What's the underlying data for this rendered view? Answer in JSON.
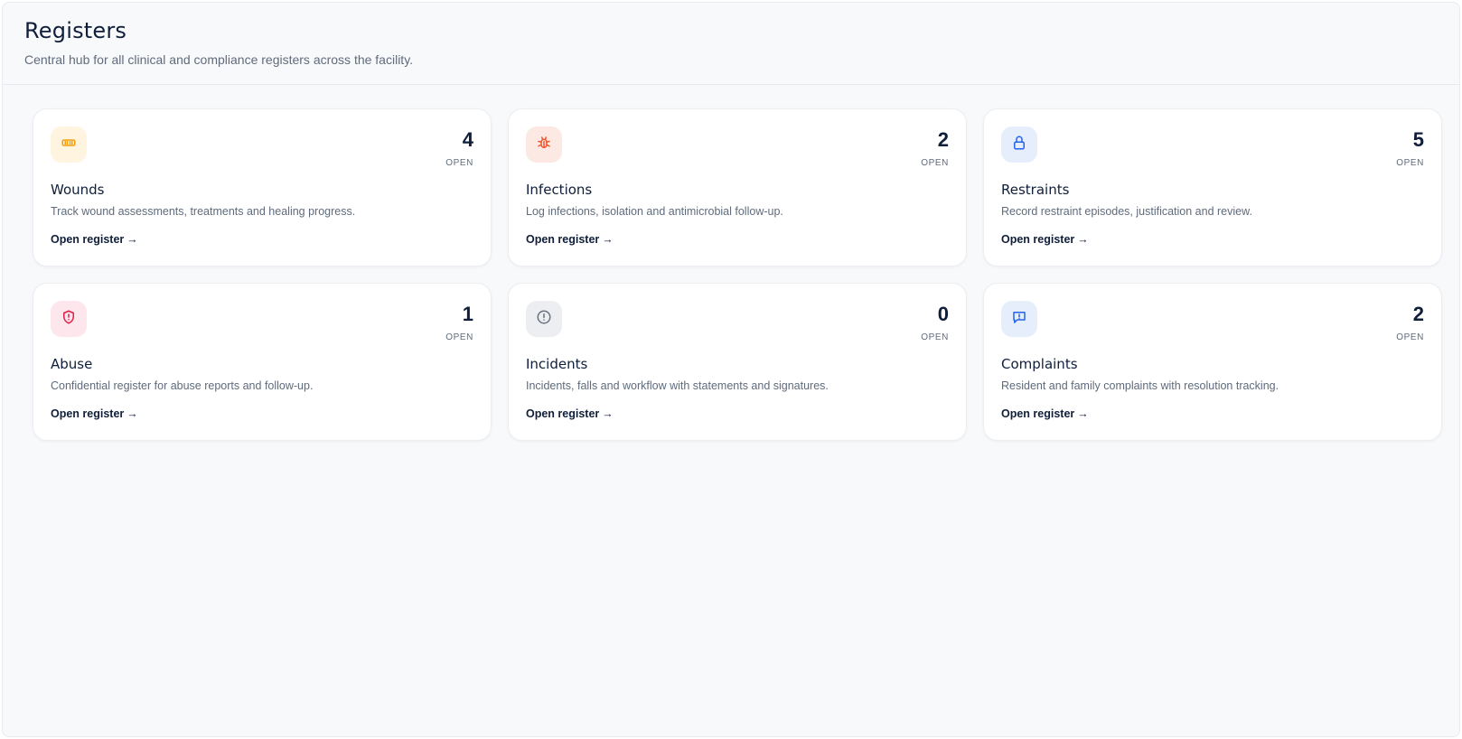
{
  "header": {
    "title": "Registers",
    "subtitle": "Central hub for all clinical and compliance registers across the facility."
  },
  "registers": [
    {
      "title": "Wounds",
      "count": "4",
      "open_label": "OPEN",
      "description": "Track wound assessments, treatments and healing progress.",
      "link_label": "Open register",
      "arrow": "→",
      "icon": "bandage-icon",
      "icon_color": "#f59e0b",
      "icon_bg": "#fff4e0"
    },
    {
      "title": "Infections",
      "count": "2",
      "open_label": "OPEN",
      "description": "Log infections, isolation and antimicrobial follow-up.",
      "link_label": "Open register",
      "arrow": "→",
      "icon": "bug-icon",
      "icon_color": "#f0542e",
      "icon_bg": "#fde9e3"
    },
    {
      "title": "Restraints",
      "count": "5",
      "open_label": "OPEN",
      "description": "Record restraint episodes, justification and review.",
      "link_label": "Open register",
      "arrow": "→",
      "icon": "lock-icon",
      "icon_color": "#2563eb",
      "icon_bg": "#e6eefc"
    },
    {
      "title": "Abuse",
      "count": "1",
      "open_label": "OPEN",
      "description": "Confidential register for abuse reports and follow-up.",
      "link_label": "Open register",
      "arrow": "→",
      "icon": "shield-alert-icon",
      "icon_color": "#e11d48",
      "icon_bg": "#fde7ec"
    },
    {
      "title": "Incidents",
      "count": "0",
      "open_label": "OPEN",
      "description": "Incidents, falls and workflow with statements and signatures.",
      "link_label": "Open register",
      "arrow": "→",
      "icon": "alert-circle-icon",
      "icon_color": "#6b7280",
      "icon_bg": "#eceef1"
    },
    {
      "title": "Complaints",
      "count": "2",
      "open_label": "OPEN",
      "description": "Resident and family complaints with resolution tracking.",
      "link_label": "Open register",
      "arrow": "→",
      "icon": "message-alert-icon",
      "icon_color": "#2563eb",
      "icon_bg": "#e6eefc"
    }
  ]
}
